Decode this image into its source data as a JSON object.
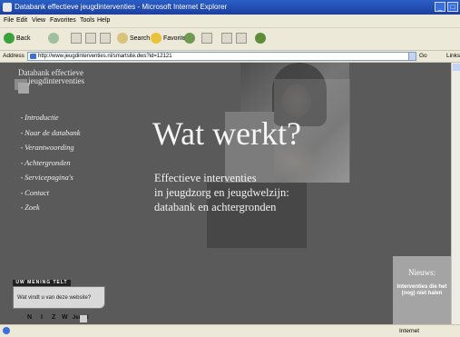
{
  "window": {
    "title": "Databank effectieve jeugdinterventies - Microsoft Internet Explorer"
  },
  "menu": {
    "items": [
      "File",
      "Edit",
      "View",
      "Favorites",
      "Tools",
      "Help"
    ]
  },
  "toolbar": {
    "back_label": "Back",
    "search_label": "Search",
    "favorites_label": "Favorites"
  },
  "address": {
    "label": "Address",
    "url": "http://www.jeugdinterventies.nl/smartsite.dws?id=12121",
    "go_label": "Go",
    "links_label": "Links"
  },
  "site": {
    "logo_line1": "Databank effectieve",
    "logo_line2": "jeugdinterventies",
    "nav": [
      "Introductie",
      "Naar de databank",
      "Verantwoording",
      "Achtergronden",
      "Servicepagina's",
      "Contact",
      "Zoek"
    ],
    "headline": "Wat werkt?",
    "subline": [
      "Effectieve interventies",
      "in jeugdzorg en jeugdwelzijn:",
      "databank en achtergronden"
    ],
    "nieuws_title": "Nieuws:",
    "nieuws_body": "Interventies die het (nog) niet halen",
    "opinion_tab": "UW MENING TELT",
    "opinion_text": "Wat vindt u van deze website?",
    "nizw_letters": [
      "N",
      "I",
      "Z",
      "W"
    ],
    "nizw_word": "Jeugd"
  },
  "status": {
    "zone": "Internet"
  },
  "colors": {
    "page_bg": "#5a5a5a",
    "titlebar": "#2a5fc7",
    "chrome": "#ece9d8"
  }
}
